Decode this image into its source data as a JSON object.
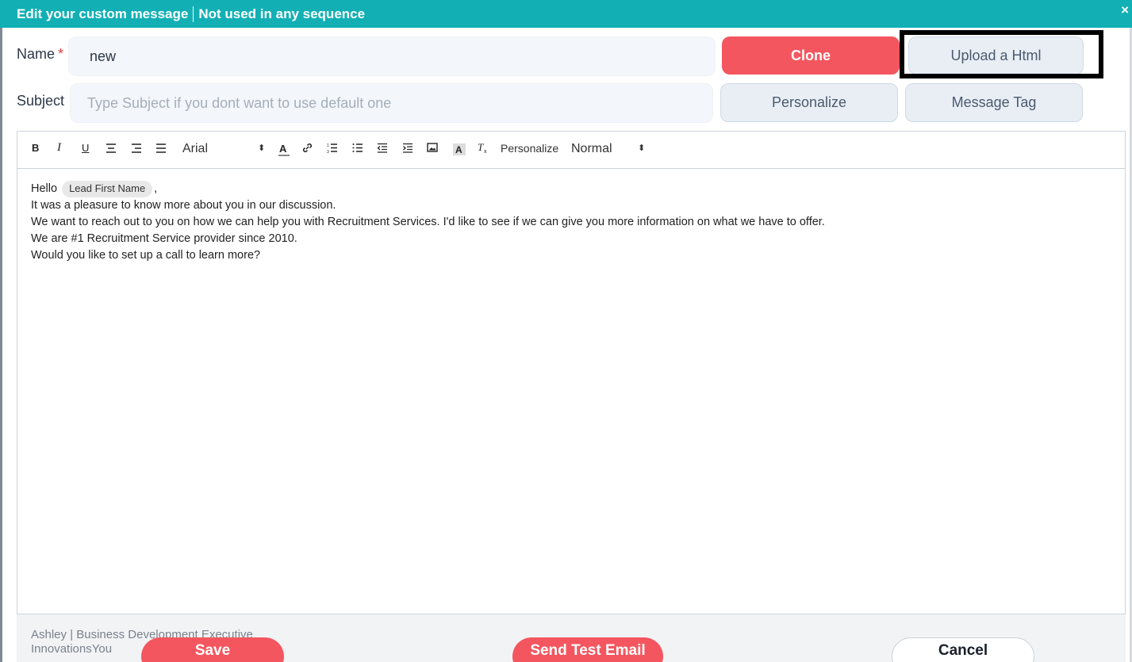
{
  "header": {
    "title": "Edit your custom message",
    "status": "Not used in any sequence",
    "close": "×"
  },
  "form": {
    "name_label": "Name",
    "required_mark": "*",
    "name_value": "new",
    "subject_label": "Subject",
    "subject_placeholder": "Type Subject if you dont want to use default one"
  },
  "actions": {
    "clone": "Clone",
    "upload_html": "Upload a Html",
    "personalize": "Personalize",
    "message_tag": "Message Tag"
  },
  "toolbar": {
    "bold": "B",
    "italic": "I",
    "underline": "U",
    "font": "Arial",
    "personalize": "Personalize",
    "size": "Normal",
    "caret": "⬍"
  },
  "body": {
    "greeting": "Hello",
    "tag": "Lead First Name",
    "comma": ",",
    "line2": "It was a pleasure to know more about you in our discussion.",
    "line3": "We want to reach out to you on how we can help you with Recruitment Services. I'd like to see if we can give you more information on what we have to offer.",
    "line4": "We are #1 Recruitment Service provider since 2010.",
    "line5": "Would you like to set up a call to learn more?"
  },
  "signature": {
    "line1": "Ashley | Business Development Executive",
    "line2": "InnovationsYou"
  },
  "footer": {
    "save": "Save",
    "send_test": "Send Test Email",
    "cancel": "Cancel"
  },
  "colors": {
    "header": "#12b0b5",
    "primary_red": "#f4565f",
    "grey_button": "#e9eef5"
  }
}
